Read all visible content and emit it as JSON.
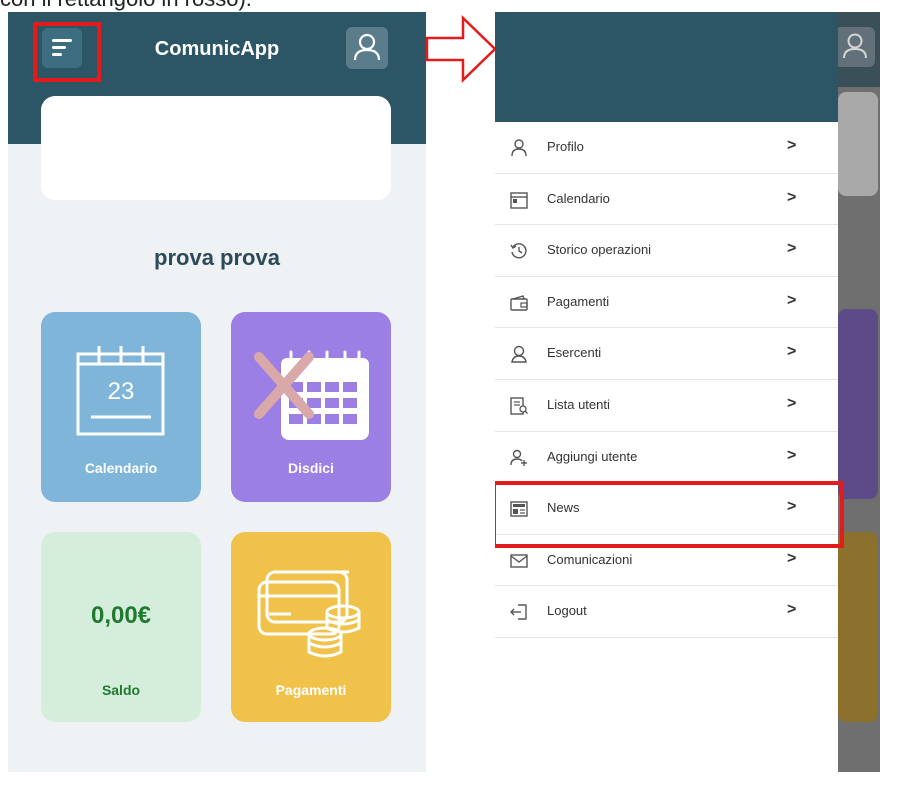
{
  "caption": "con il rettangolo in rosso).",
  "left": {
    "app_title": "ComunicApp",
    "user_name": "prova prova",
    "tiles": {
      "calendar_day": "23",
      "calendar_label": "Calendario",
      "disdici_label": "Disdici",
      "saldo_amount": "0,00€",
      "saldo_label": "Saldo",
      "pagamenti_label": "Pagamenti"
    }
  },
  "drawer": {
    "items": [
      {
        "label": "Profilo",
        "icon": "user-icon"
      },
      {
        "label": "Calendario",
        "icon": "calendar-icon"
      },
      {
        "label": "Storico operazioni",
        "icon": "history-icon"
      },
      {
        "label": "Pagamenti",
        "icon": "wallet-icon"
      },
      {
        "label": "Esercenti",
        "icon": "merchant-icon"
      },
      {
        "label": "Lista utenti",
        "icon": "user-list-icon"
      },
      {
        "label": "Aggiungi utente",
        "icon": "add-user-icon"
      },
      {
        "label": "News",
        "icon": "news-icon"
      },
      {
        "label": "Comunicazioni",
        "icon": "mail-icon"
      },
      {
        "label": "Logout",
        "icon": "logout-icon"
      }
    ],
    "chevron": ">"
  },
  "colors": {
    "header": "#2c5566",
    "highlight": "#e31b1b",
    "calendar_tile": "#7fb5d8",
    "disdici_tile": "#9b7fe4",
    "saldo_tile": "#d5eedb",
    "pagamenti_tile": "#f0c24a"
  }
}
